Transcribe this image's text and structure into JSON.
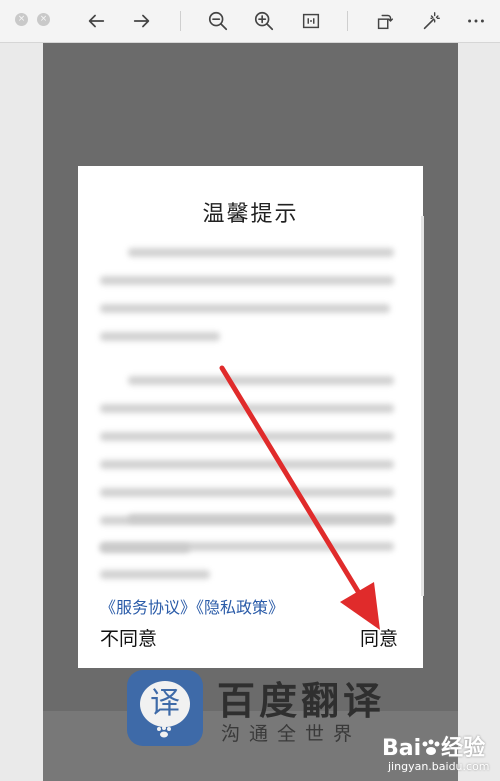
{
  "toolbar": {
    "close_label": "×",
    "min_label": "×",
    "icons": [
      "back-arrow-icon",
      "forward-arrow-icon",
      "zoom-out-icon",
      "zoom-in-icon",
      "fit-icon",
      "rotate-icon",
      "magic-wand-icon",
      "more-icon"
    ]
  },
  "background_app": {
    "logo_char": "译",
    "name": "百度翻译",
    "slogan": "沟通全世界"
  },
  "dialog": {
    "title": "温馨提示",
    "link_service": "《服务协议》",
    "link_privacy": "《隐私政策》",
    "disagree": "不同意",
    "agree": "同意"
  },
  "watermark": {
    "main": "Bai",
    "main_suffix": "经验",
    "sub": "jingyan.baidu.com"
  },
  "colors": {
    "stage": "#6b6b6b",
    "link": "#2a5ba8",
    "arrow": "#e02b2b",
    "logo": "#3e6aa8"
  }
}
